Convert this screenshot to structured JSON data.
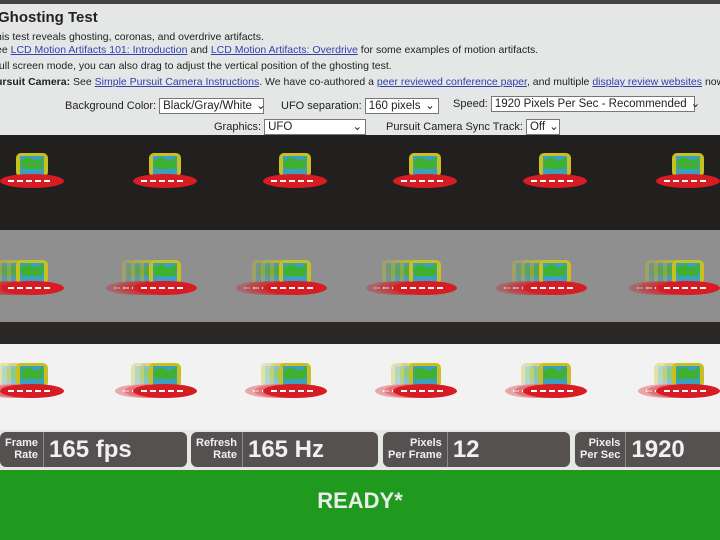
{
  "title": "Ghosting Test",
  "intro": {
    "line1": "his test reveals ghosting, coronas, and overdrive artifacts.",
    "line2_prefix": "ee ",
    "link1": "LCD Motion Artifacts 101: Introduction",
    "line2_mid": " and ",
    "link2": "LCD Motion Artifacts: Overdrive",
    "line2_suffix": " for some examples of motion artifacts.",
    "line3": " full screen mode, you can also drag to adjust the vertical position of the ghosting test.",
    "line4_bold": "ursuit Camera:",
    "line4_a": " See ",
    "link3": "Simple Pursuit Camera Instructions",
    "line4_b": ". We have co-authored a ",
    "link4": "peer reviewed conference paper",
    "line4_c": ", and multiple ",
    "link5": "display review websites",
    "line4_d": " now use th"
  },
  "controls": {
    "background_label": "Background Color:",
    "background_value": "Black/Gray/White",
    "separation_label": "UFO separation:",
    "separation_value": "160 pixels",
    "speed_label": "Speed:",
    "speed_value": "1920 Pixels Per Sec - Recommended",
    "graphics_label": "Graphics:",
    "graphics_value": "UFO",
    "sync_label": "Pursuit Camera Sync Track:",
    "sync_value": "Off"
  },
  "stats": [
    {
      "label1": "Frame",
      "label2": "Rate",
      "value": "165 fps"
    },
    {
      "label1": "Refresh",
      "label2": "Rate",
      "value": "165 Hz"
    },
    {
      "label1": "Pixels",
      "label2": "Per Frame",
      "value": "12"
    },
    {
      "label1": "Pixels",
      "label2": "Per Sec",
      "value": "1920"
    }
  ],
  "status": "READY*",
  "colors": {
    "black_band": "#221f1f",
    "gray_band": "#8f8f8f",
    "white_band": "#f2f2f2",
    "ready": "#1f9a1f"
  }
}
